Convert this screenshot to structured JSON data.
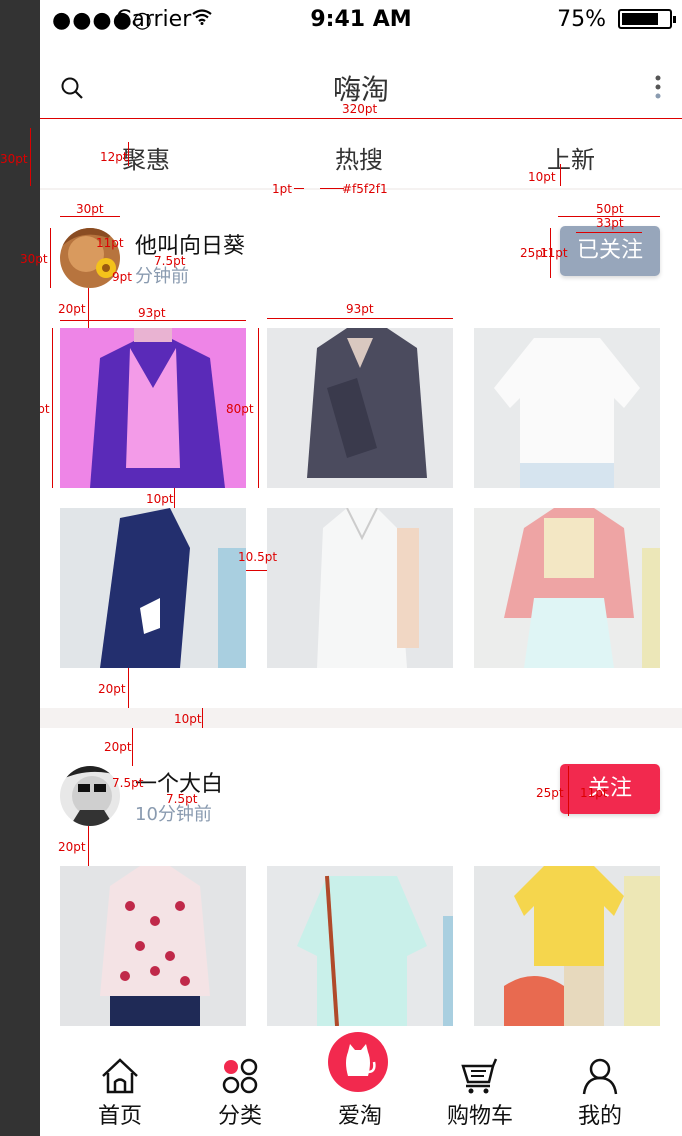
{
  "status_bar": {
    "signal": "●●●●○",
    "carrier": "Carrier",
    "time": "9:41 AM",
    "battery": "75%",
    "battery_level": 0.75
  },
  "nav": {
    "title": "嗨淘",
    "left_icon": "search-icon",
    "right_icon": "more-vertical-icon"
  },
  "tabs": [
    {
      "label": "聚惠"
    },
    {
      "label": "热搜"
    },
    {
      "label": "上新"
    }
  ],
  "posts": [
    {
      "user": "他叫向日葵",
      "time": "分钟前",
      "follow_label": "已关注",
      "follow_color": "#97a6bb",
      "images": [
        "purple-jacket-photo",
        "mesh-jacket-photo",
        "white-tee-photo",
        "navy-coat-photo",
        "white-vest-photo",
        "pink-bomber-photo"
      ]
    },
    {
      "user": "一个大白",
      "time": "10分钟前",
      "follow_label": "关注",
      "follow_color": "#f2294e",
      "images": [
        "red-print-top-photo",
        "mint-shirt-photo",
        "yellow-top-photo"
      ]
    }
  ],
  "tabbar": [
    {
      "label": "首页",
      "icon": "home-icon"
    },
    {
      "label": "分类",
      "icon": "category-icon"
    },
    {
      "label": "爱淘",
      "icon": "cat-icon"
    },
    {
      "label": "购物车",
      "icon": "cart-icon"
    },
    {
      "label": "我的",
      "icon": "user-icon"
    }
  ],
  "annotations": {
    "width_320": "320pt",
    "h30": "30pt",
    "t12": "12pt",
    "t10": "10pt",
    "line1": "1pt",
    "color": "#f5f2f1",
    "a30": "30pt",
    "a30v": "30pt",
    "t11": "11pt",
    "t75": "7.5pt",
    "t9": "9pt",
    "f50": "50pt",
    "f33": "33pt",
    "f25": "25pt",
    "f11": "11pt",
    "p20": "20pt",
    "w93a": "93pt",
    "w93b": "93pt",
    "h80a": "80pt",
    "h80b": "80pt",
    "g10": "10pt",
    "g105": "10.5pt",
    "b20": "20pt",
    "s10": "10pt",
    "c20": "20pt",
    "n75": "7.5pt",
    "n75b": "7.5pt",
    "g25": "25pt",
    "g11": "11pt",
    "d20": "20pt"
  }
}
